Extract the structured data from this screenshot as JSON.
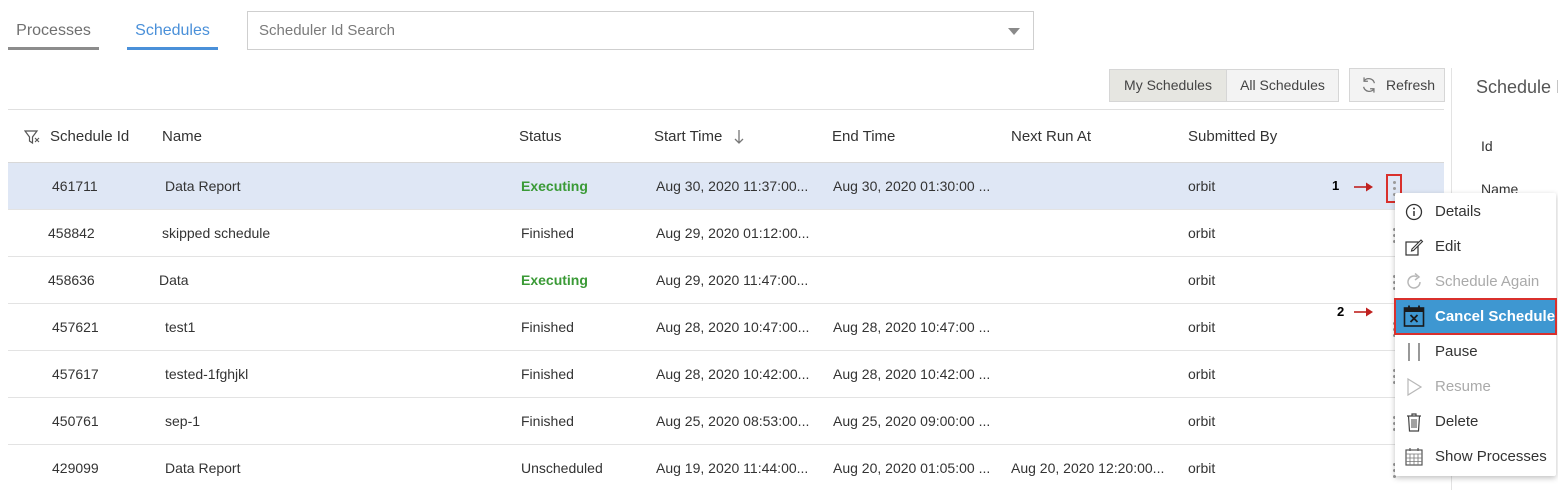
{
  "tabs": [
    {
      "label": "Processes"
    },
    {
      "label": "Schedules"
    }
  ],
  "search": {
    "placeholder": "Scheduler Id Search"
  },
  "toolbar": {
    "my_schedules": "My Schedules",
    "all_schedules": "All Schedules",
    "refresh": "Refresh"
  },
  "side_panel": {
    "title": "Schedule I",
    "id_label": "Id",
    "name_label": "Name"
  },
  "table": {
    "headers": {
      "id": "Schedule Id",
      "name": "Name",
      "status": "Status",
      "start": "Start Time",
      "end": "End Time",
      "next": "Next Run At",
      "by": "Submitted By"
    },
    "rows": [
      {
        "id": "461711",
        "name": "Data Report",
        "status": "Executing",
        "start": "Aug 30, 2020 11:37:00...",
        "end": "Aug 30, 2020 01:30:00 ...",
        "next": "",
        "by": "orbit"
      },
      {
        "id": "458842",
        "name": "skipped schedule",
        "status": "Finished",
        "start": "Aug 29, 2020 01:12:00...",
        "end": "",
        "next": "",
        "by": "orbit"
      },
      {
        "id": "458636",
        "name": "Data",
        "status": "Executing",
        "start": "Aug 29, 2020 11:47:00...",
        "end": "",
        "next": "",
        "by": "orbit"
      },
      {
        "id": "457621",
        "name": "test1",
        "status": "Finished",
        "start": "Aug 28, 2020 10:47:00...",
        "end": "Aug 28, 2020 10:47:00 ...",
        "next": "",
        "by": "orbit"
      },
      {
        "id": "457617",
        "name": "tested-1fghjkl",
        "status": "Finished",
        "start": "Aug 28, 2020 10:42:00...",
        "end": "Aug 28, 2020 10:42:00 ...",
        "next": "",
        "by": "orbit"
      },
      {
        "id": "450761",
        "name": "sep-1",
        "status": "Finished",
        "start": "Aug 25, 2020 08:53:00...",
        "end": "Aug 25, 2020 09:00:00 ...",
        "next": "",
        "by": "orbit"
      },
      {
        "id": "429099",
        "name": "Data Report",
        "status": "Unscheduled",
        "start": "Aug 19, 2020 11:44:00...",
        "end": "Aug 20, 2020 01:05:00 ...",
        "next": "Aug 20, 2020 12:20:00...",
        "by": "orbit"
      }
    ]
  },
  "annotations": {
    "step1": "1",
    "step2": "2"
  },
  "context_menu": {
    "items": [
      {
        "label": "Details",
        "icon": "info-icon"
      },
      {
        "label": "Edit",
        "icon": "edit-icon"
      },
      {
        "label": "Schedule Again",
        "icon": "redo-icon"
      },
      {
        "label": "Cancel Schedule",
        "icon": "calendar-cancel-icon"
      },
      {
        "label": "Pause",
        "icon": "pause-icon"
      },
      {
        "label": "Resume",
        "icon": "play-icon"
      },
      {
        "label": "Delete",
        "icon": "trash-icon"
      },
      {
        "label": "Show Processes",
        "icon": "calendar-grid-icon"
      }
    ]
  },
  "colors": {
    "accent": "#4a90d9",
    "executing": "#3a9a36",
    "selected_row": "#dfe7f5",
    "menu_active": "#3e97d1",
    "highlight_red": "#d9302c"
  }
}
